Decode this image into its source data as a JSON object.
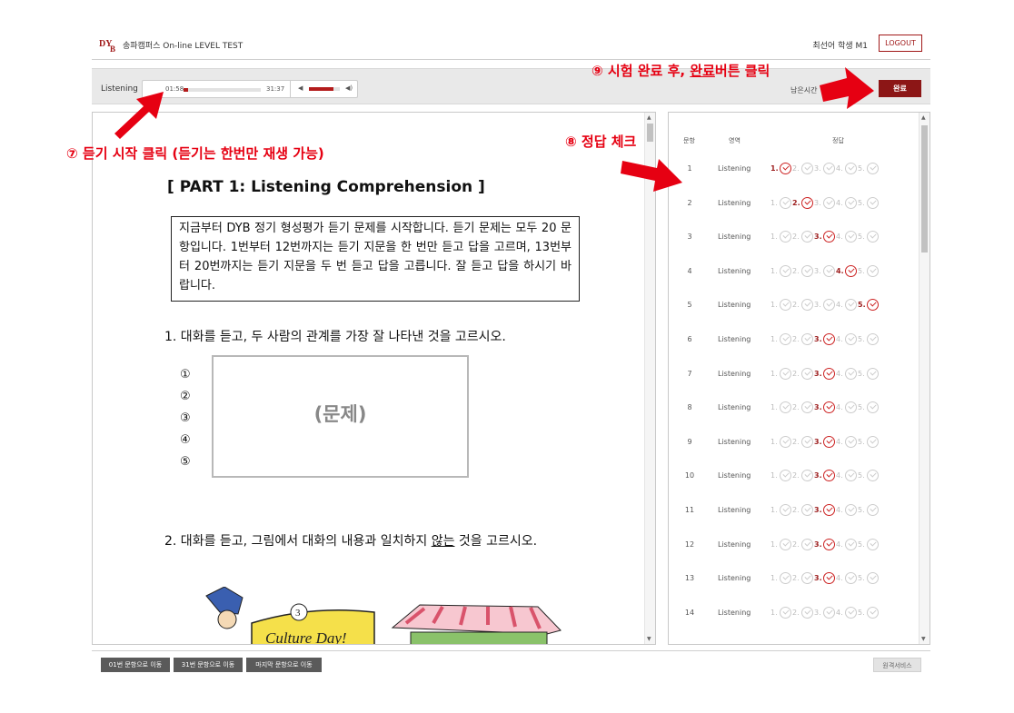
{
  "header": {
    "brand": "송파캠퍼스 On-line LEVEL TEST",
    "user": "최선어 학생 M1",
    "logout": "LOGOUT"
  },
  "player": {
    "section": "Listening",
    "current_time": "01:58",
    "total_time": "31:37",
    "progress": 0.06,
    "volume": 0.8,
    "remaining_label": "남은시간",
    "finish": "완료"
  },
  "question_panel": {
    "part_title": "[ PART 1: Listening Comprehension ]",
    "instructions": "지금부터 DYB 정기 형성평가 듣기 문제를 시작합니다. 듣기 문제는 모두 20 문항입니다. 1번부터 12번까지는 듣기 지문을 한 번만 듣고 답을 고르며, 13번부터 20번까지는 듣기 지문을 두 번 듣고 답을 고릅니다. 잘 듣고 답을 하시기 바랍니다.",
    "q1": "1. 대화를 듣고, 두 사람의 관계를 가장 잘 나타낸 것을 고르시오.",
    "options": [
      "①",
      "②",
      "③",
      "④",
      "⑤"
    ],
    "placeholder": "(문제)",
    "q2_pre": "2. 대화를 듣고, 그림에서 대화의 내용과 일치하지 ",
    "q2_under": "않는",
    "q2_post": " 것을 고르시오.",
    "cartoon_text": "Culture Day!",
    "cartoon_num": "3"
  },
  "answer_sheet": {
    "headers": {
      "num": "문항",
      "area": "영역",
      "answer": "정답"
    },
    "choice_labels": [
      "1.",
      "2.",
      "3.",
      "4.",
      "5."
    ],
    "rows": [
      {
        "num": "1",
        "area": "Listening",
        "selected": 1
      },
      {
        "num": "2",
        "area": "Listening",
        "selected": 2
      },
      {
        "num": "3",
        "area": "Listening",
        "selected": 3
      },
      {
        "num": "4",
        "area": "Listening",
        "selected": 4
      },
      {
        "num": "5",
        "area": "Listening",
        "selected": 5
      },
      {
        "num": "6",
        "area": "Listening",
        "selected": 3
      },
      {
        "num": "7",
        "area": "Listening",
        "selected": 3
      },
      {
        "num": "8",
        "area": "Listening",
        "selected": 3
      },
      {
        "num": "9",
        "area": "Listening",
        "selected": 3
      },
      {
        "num": "10",
        "area": "Listening",
        "selected": 3
      },
      {
        "num": "11",
        "area": "Listening",
        "selected": 3
      },
      {
        "num": "12",
        "area": "Listening",
        "selected": 3
      },
      {
        "num": "13",
        "area": "Listening",
        "selected": 3
      },
      {
        "num": "14",
        "area": "Listening",
        "selected": 0
      }
    ]
  },
  "bottom": {
    "go_q1": "01번 문항으로 이동",
    "go_q31": "31번 문항으로 이동",
    "go_last": "마지막 문항으로 이동",
    "remote": "원격서비스"
  },
  "annotations": {
    "a7": "⑦ 듣기 시작 클릭 (듣기는 한번만 재생 가능)",
    "a8": "⑧ 정답 체크",
    "a9_pre": "⑨ 시험 완료 후, ",
    "a9_under": "완료",
    "a9_post": "버튼 클릭"
  },
  "colors": {
    "accent": "#8c1616",
    "annotation": "#e60012",
    "selected": "#c22222"
  }
}
